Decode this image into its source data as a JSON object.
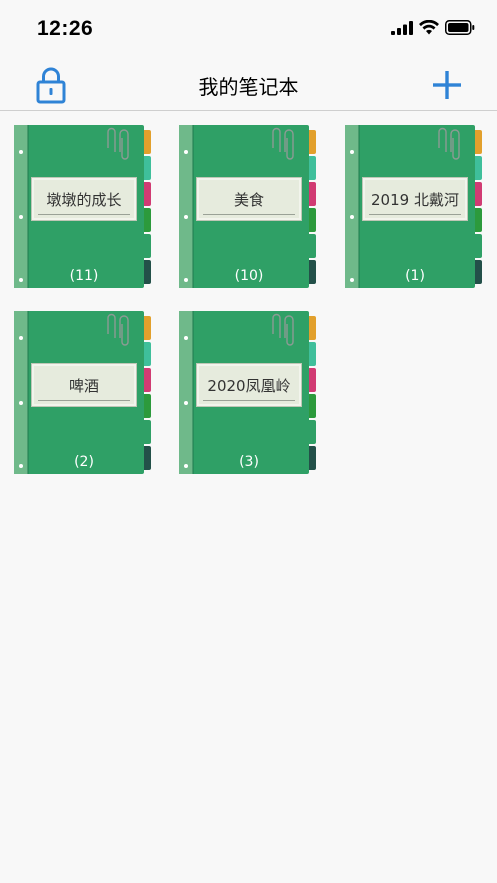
{
  "status": {
    "time": "12:26"
  },
  "nav": {
    "title": "我的笔记本",
    "lock_icon": "lock-icon",
    "add_icon": "plus-icon"
  },
  "colors": {
    "accent": "#2f83d6",
    "cover": "#2fa066",
    "spine": "#6fb98a",
    "tabs": [
      "#e2a02c",
      "#3fbf9b",
      "#d13b73",
      "#2c9a3c",
      "#2fa066",
      "#235049"
    ]
  },
  "notebooks": [
    {
      "title": "墩墩的成长",
      "count": "(11)"
    },
    {
      "title": "美食",
      "count": "(10)"
    },
    {
      "title": "2019 北戴河",
      "count": "(1)"
    },
    {
      "title": "啤酒",
      "count": "(2)"
    },
    {
      "title": "2020凤凰岭",
      "count": "(3)"
    }
  ]
}
